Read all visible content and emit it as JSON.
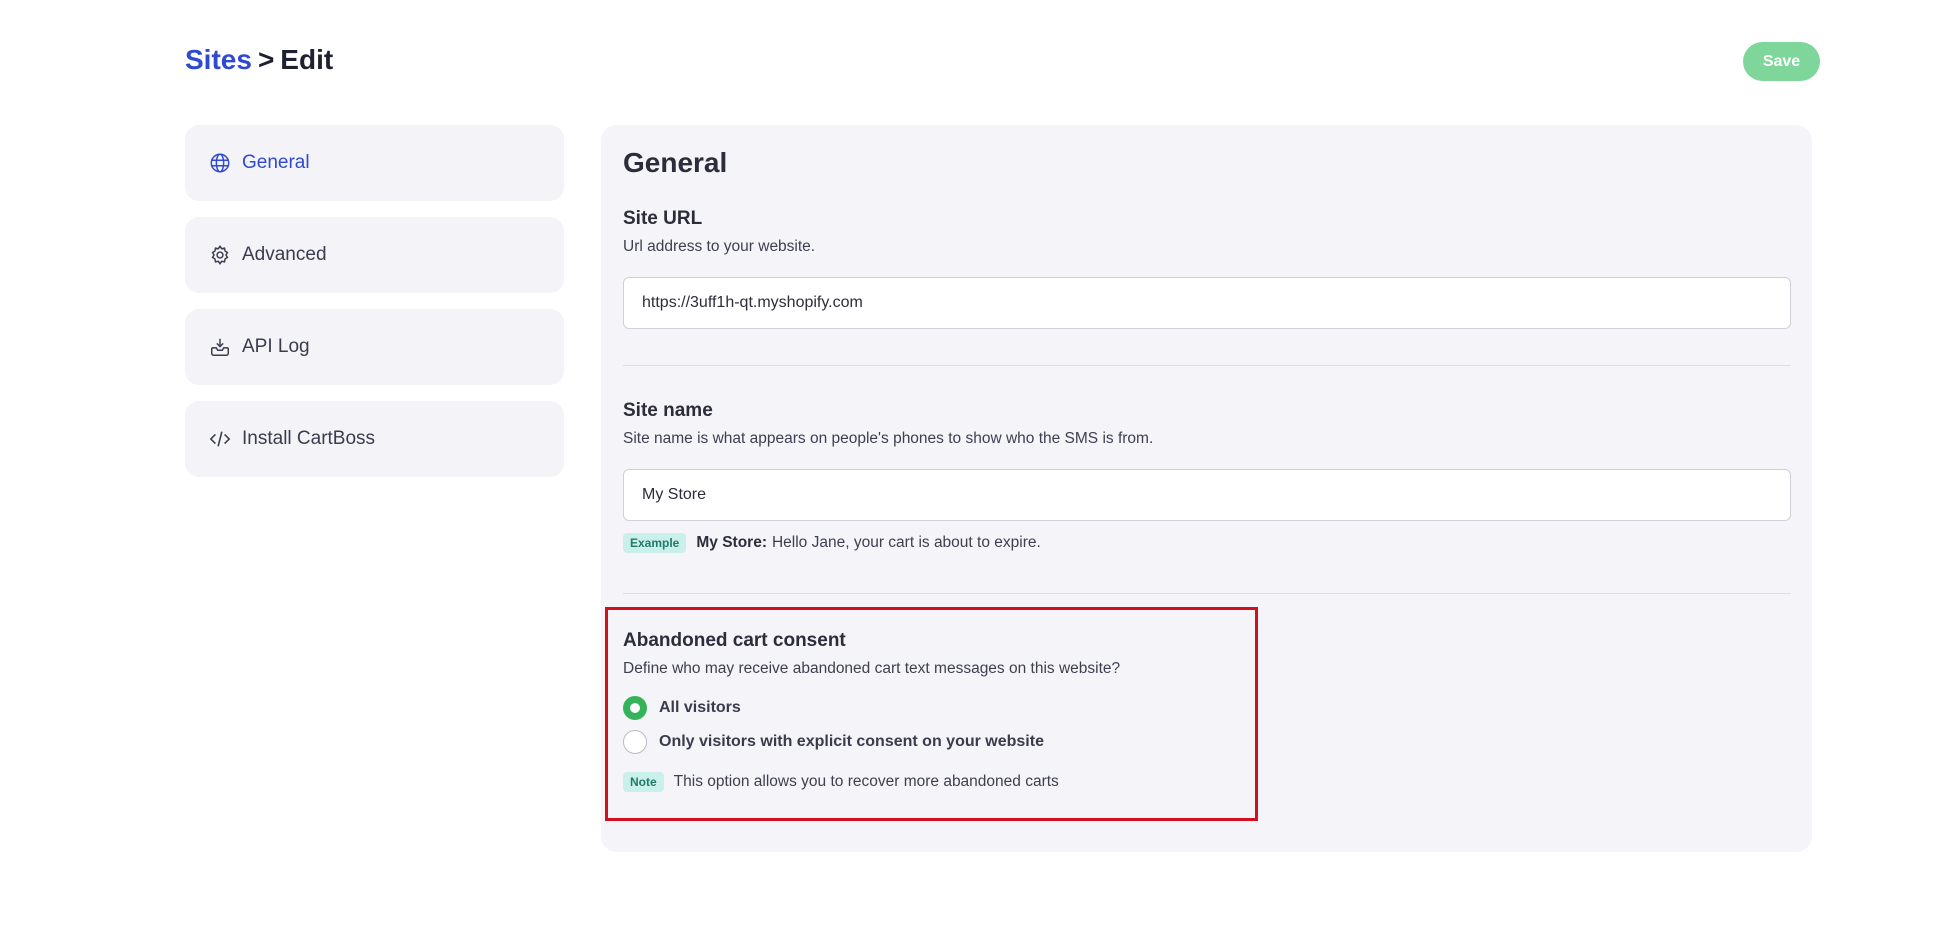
{
  "breadcrumb": {
    "parent": "Sites",
    "separator": ">",
    "current": "Edit"
  },
  "toolbar": {
    "save_label": "Save"
  },
  "sidebar": {
    "items": [
      {
        "label": "General",
        "icon": "globe-icon",
        "active": true
      },
      {
        "label": "Advanced",
        "icon": "gear-icon",
        "active": false
      },
      {
        "label": "API Log",
        "icon": "inbox-icon",
        "active": false
      },
      {
        "label": "Install CartBoss",
        "icon": "code-icon",
        "active": false
      }
    ]
  },
  "panel": {
    "title": "General",
    "site_url": {
      "title": "Site URL",
      "description": "Url address to your website.",
      "value": "https://3uff1h-qt.myshopify.com"
    },
    "site_name": {
      "title": "Site name",
      "description": "Site name is what appears on people's phones to show who the SMS is from.",
      "value": "My Store",
      "example_tag": "Example",
      "example_bold": "My Store:",
      "example_text": "Hello Jane, your cart is about to expire."
    },
    "consent": {
      "title": "Abandoned cart consent",
      "description": "Define who may receive abandoned cart text messages on this website?",
      "options": [
        {
          "label": "All visitors",
          "selected": true
        },
        {
          "label": "Only visitors with explicit consent on your website",
          "selected": false
        }
      ],
      "note_tag": "Note",
      "note_text": "This option allows you to recover more abandoned carts"
    }
  },
  "colors": {
    "accent": "#2f49d1",
    "save_button": "#7fd69a",
    "radio_selected": "#34b35a",
    "highlight_border": "#d0101f",
    "tag_bg": "#c9f0ea"
  }
}
